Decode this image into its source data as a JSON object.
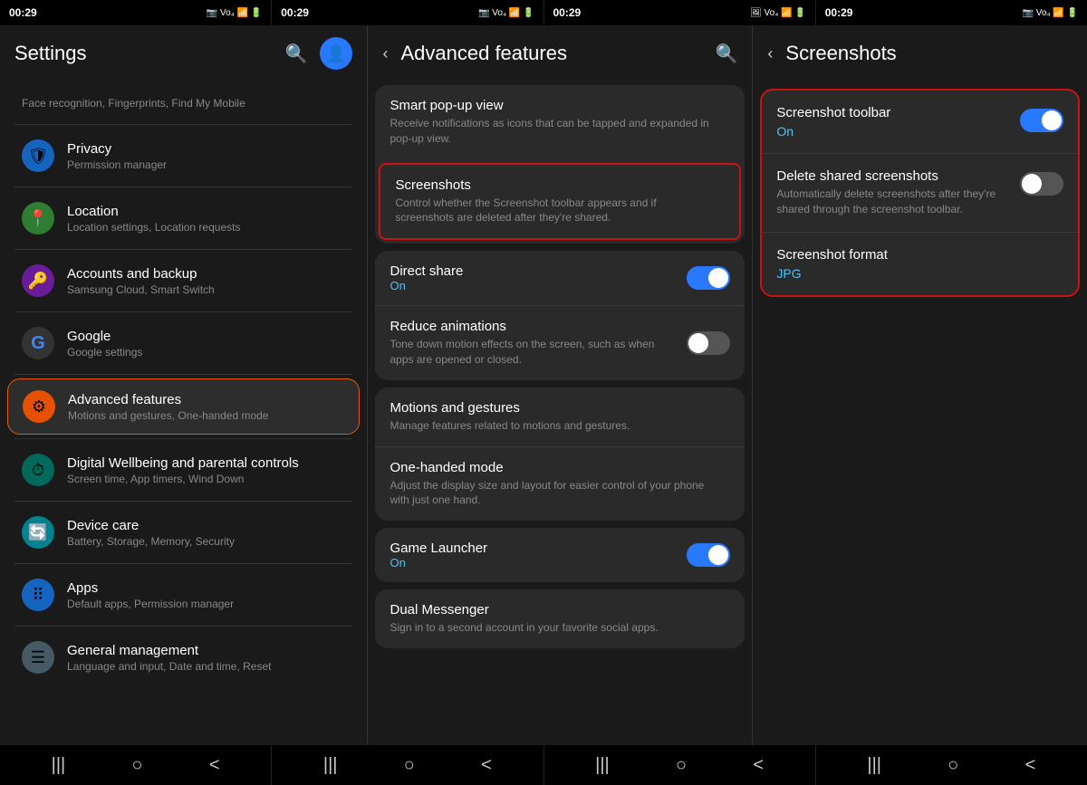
{
  "statusBar": {
    "time": "00:29",
    "icons": "📷 ◎ ⬤",
    "networkIcons": "🔔 📶 🔋"
  },
  "panel1": {
    "title": "Settings",
    "items": [
      {
        "id": "face-recognition",
        "label": "Face recognition, Fingerprints, Find My Mobile",
        "subtitle": "",
        "icon": "🛡",
        "iconBg": "#222",
        "active": false
      },
      {
        "id": "privacy",
        "label": "Privacy",
        "subtitle": "Permission manager",
        "icon": "🛡",
        "iconBg": "#1565c0",
        "active": false
      },
      {
        "id": "location",
        "label": "Location",
        "subtitle": "Location settings, Location requests",
        "icon": "📍",
        "iconBg": "#2e7d32",
        "active": false
      },
      {
        "id": "accounts",
        "label": "Accounts and backup",
        "subtitle": "Samsung Cloud, Smart Switch",
        "icon": "🔑",
        "iconBg": "#6a1b9a",
        "active": false
      },
      {
        "id": "google",
        "label": "Google",
        "subtitle": "Google settings",
        "icon": "G",
        "iconBg": "#222",
        "active": false
      },
      {
        "id": "advanced",
        "label": "Advanced features",
        "subtitle": "Motions and gestures, One-handed mode",
        "icon": "⚙",
        "iconBg": "#e65100",
        "active": true
      },
      {
        "id": "wellbeing",
        "label": "Digital Wellbeing and parental controls",
        "subtitle": "Screen time, App timers, Wind Down",
        "icon": "⏱",
        "iconBg": "#00695c",
        "active": false
      },
      {
        "id": "device-care",
        "label": "Device care",
        "subtitle": "Battery, Storage, Memory, Security",
        "icon": "🔄",
        "iconBg": "#00838f",
        "active": false
      },
      {
        "id": "apps",
        "label": "Apps",
        "subtitle": "Default apps, Permission manager",
        "icon": "⠿",
        "iconBg": "#1565c0",
        "active": false
      },
      {
        "id": "general",
        "label": "General management",
        "subtitle": "Language and input, Date and time, Reset",
        "icon": "☰",
        "iconBg": "#455a64",
        "active": false
      }
    ]
  },
  "panel2": {
    "title": "Advanced features",
    "cards": [
      {
        "id": "card1",
        "highlighted": false,
        "items": [
          {
            "id": "smart-popup",
            "title": "Smart pop-up view",
            "subtitle": "Receive notifications as icons that can be tapped and expanded in pop-up view.",
            "toggle": null
          },
          {
            "id": "screenshots",
            "title": "Screenshots",
            "subtitle": "Control whether the Screenshot toolbar appears and if screenshots are deleted after they're shared.",
            "toggle": null,
            "highlighted": true
          }
        ]
      },
      {
        "id": "card2",
        "highlighted": false,
        "items": [
          {
            "id": "direct-share",
            "title": "Direct share",
            "status": "On",
            "toggle": "on"
          },
          {
            "id": "reduce-animations",
            "title": "Reduce animations",
            "subtitle": "Tone down motion effects on the screen, such as when apps are opened or closed.",
            "toggle": "off"
          }
        ]
      },
      {
        "id": "card3",
        "highlighted": false,
        "items": [
          {
            "id": "motions",
            "title": "Motions and gestures",
            "subtitle": "Manage features related to motions and gestures."
          },
          {
            "id": "one-handed",
            "title": "One-handed mode",
            "subtitle": "Adjust the display size and layout for easier control of your phone with just one hand."
          }
        ]
      },
      {
        "id": "card4",
        "highlighted": false,
        "items": [
          {
            "id": "game-launcher",
            "title": "Game Launcher",
            "status": "On",
            "toggle": "on"
          }
        ]
      },
      {
        "id": "card5",
        "highlighted": false,
        "items": [
          {
            "id": "dual-messenger",
            "title": "Dual Messenger",
            "subtitle": "Sign in to a second account in your favorite social apps."
          }
        ]
      }
    ]
  },
  "panel3": {
    "title": "Screenshots",
    "items": [
      {
        "id": "screenshot-toolbar",
        "title": "Screenshot toolbar",
        "status": "On",
        "toggle": "on"
      },
      {
        "id": "delete-shared",
        "title": "Delete shared screenshots",
        "subtitle": "Automatically delete screenshots after they're shared through the screenshot toolbar.",
        "toggle": "off"
      },
      {
        "id": "screenshot-format",
        "title": "Screenshot format",
        "value": "JPG"
      }
    ]
  },
  "nav": {
    "recent": "|||",
    "home": "○",
    "back": "<"
  }
}
